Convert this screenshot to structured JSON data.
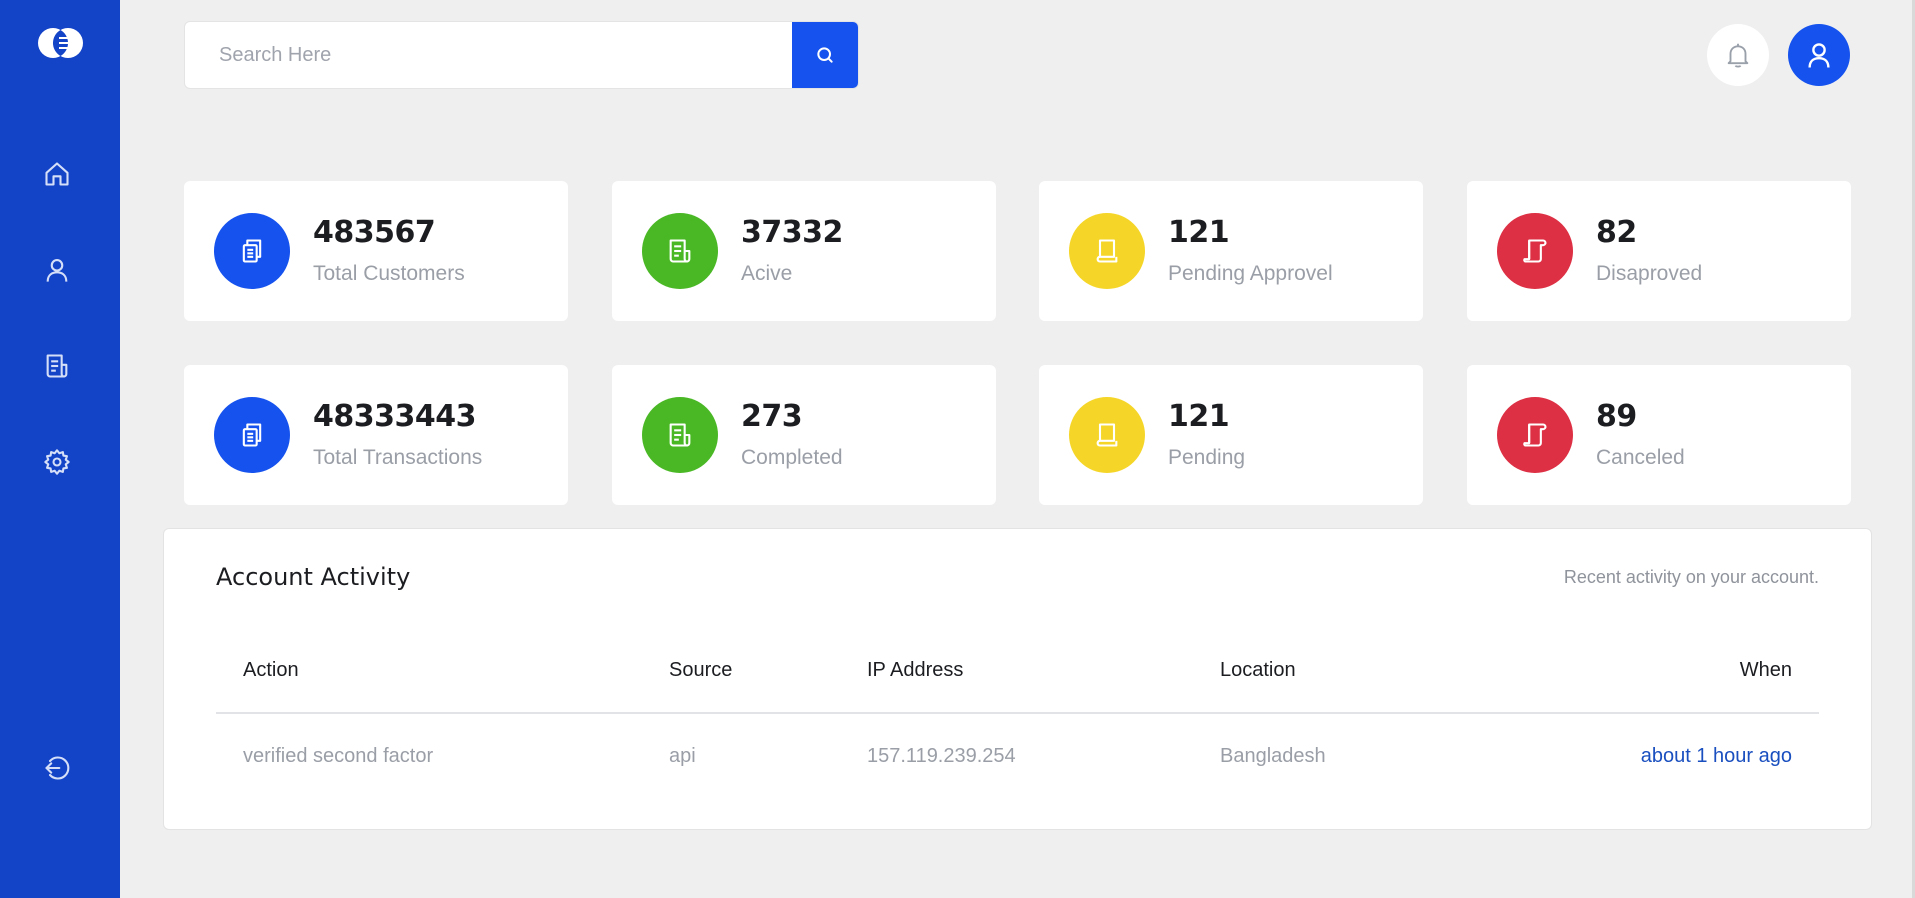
{
  "search": {
    "placeholder": "Search Here"
  },
  "sidebar": {
    "items": [
      "home-icon",
      "user-icon",
      "document-icon",
      "gear-icon"
    ],
    "logout": "logout-icon"
  },
  "colors": {
    "sidebar": "#1343c7",
    "primary": "#1552ee",
    "green": "#4ab825",
    "yellow": "#f5d628",
    "red": "#dd3044",
    "link": "#1a4fbf"
  },
  "stats": [
    {
      "value": "483567",
      "label": "Total Customers",
      "color": "#1552ee",
      "icon": "copy-icon"
    },
    {
      "value": "37332",
      "label": "Acive",
      "color": "#4ab825",
      "icon": "receipt-icon"
    },
    {
      "value": "121",
      "label": "Pending Approvel",
      "color": "#f5d628",
      "icon": "book-icon"
    },
    {
      "value": "82",
      "label": "Disaproved",
      "color": "#dd3044",
      "icon": "scroll-icon"
    },
    {
      "value": "48333443",
      "label": "Total Transactions",
      "color": "#1552ee",
      "icon": "copy-icon"
    },
    {
      "value": "273",
      "label": "Completed",
      "color": "#4ab825",
      "icon": "receipt-icon"
    },
    {
      "value": "121",
      "label": "Pending",
      "color": "#f5d628",
      "icon": "book-icon"
    },
    {
      "value": "89",
      "label": "Canceled",
      "color": "#dd3044",
      "icon": "scroll-icon"
    }
  ],
  "activity": {
    "title": "Account Activity",
    "subtitle": "Recent activity on your account.",
    "columns": [
      "Action",
      "Source",
      "IP Address",
      "Location",
      "When"
    ],
    "rows": [
      {
        "action": "verified second factor",
        "source": "api",
        "ip": "157.119.239.254",
        "location": "Bangladesh",
        "when": "about 1 hour ago"
      }
    ]
  }
}
